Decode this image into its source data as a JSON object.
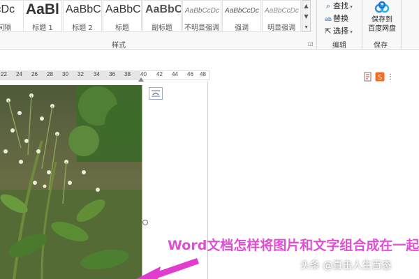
{
  "ribbon": {
    "styles_gallery": [
      {
        "sample": "CcDc",
        "name": "间隔"
      },
      {
        "sample": "AaBl",
        "name": "标题 1"
      },
      {
        "sample": "AaBbC",
        "name": "标题 2"
      },
      {
        "sample": "AaBbC",
        "name": "标题"
      },
      {
        "sample": "AaBbC",
        "name": "副标题"
      },
      {
        "sample": "AaBbCcDc",
        "name": "不明显强调"
      },
      {
        "sample": "AaBbCcDc",
        "name": "强调"
      },
      {
        "sample": "AaBbCcDc",
        "name": "明显强调"
      }
    ],
    "styles_group_label": "样式",
    "edit": {
      "find": "查找",
      "replace": "替换",
      "select": "选择",
      "group_label": "编辑"
    },
    "save": {
      "button_line1": "保存到",
      "button_line2": "百度网盘",
      "group_label": "保存"
    }
  },
  "ruler": {
    "ticks": [
      "22",
      "24",
      "26",
      "28",
      "30",
      "32",
      "34",
      "36",
      "38",
      "40",
      "42",
      "44",
      "46",
      "48"
    ]
  },
  "document": {
    "caption": "Word文档怎样将图片和文字组合成在一起"
  },
  "watermark": "头条 @直击人生百态",
  "colors": {
    "caption": "#e04fd3",
    "arrow": "#e23bd0",
    "ribbon_bg": "#f8f8f8",
    "accent_blue": "#2b6cb0"
  },
  "icons": {
    "find": "search-icon",
    "replace": "replace-icon",
    "select": "select-cursor-icon",
    "save": "cloud-drive-icon",
    "layout_options": "layout-options-icon"
  }
}
